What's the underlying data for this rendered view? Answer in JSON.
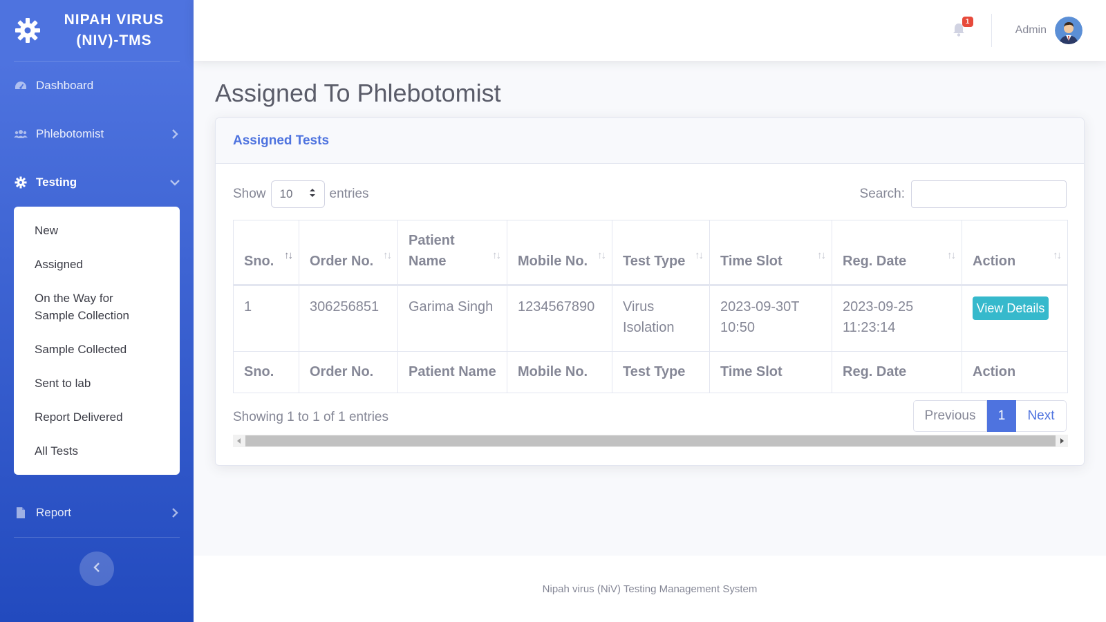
{
  "app": {
    "brand_title": "NIPAH VIRUS (NIV)-TMS",
    "accent_color": "#4e73df",
    "info_color": "#36b9cc",
    "badge_color": "#e74a3b"
  },
  "sidebar": {
    "items": [
      {
        "label": "Dashboard",
        "icon": "dashboard-gauge-icon"
      },
      {
        "label": "Phlebotomist",
        "icon": "users-icon"
      },
      {
        "label": "Testing",
        "icon": "gear-icon"
      },
      {
        "label": "Report",
        "icon": "file-icon"
      }
    ],
    "testing_submenu": [
      "New",
      "Assigned",
      "On the Way for Sample Collection",
      "Sample Collected",
      "Sent to lab",
      "Report Delivered",
      "All Tests"
    ]
  },
  "topbar": {
    "notification_count": "1",
    "user_name": "Admin"
  },
  "page": {
    "title": "Assigned To Phlebotomist",
    "card_title": "Assigned Tests"
  },
  "table_controls": {
    "show_label": "Show",
    "entries_value": "10",
    "entries_label": "entries",
    "search_label": "Search:",
    "search_value": ""
  },
  "table": {
    "columns": [
      "Sno.",
      "Order No.",
      "Patient Name",
      "Mobile No.",
      "Test Type",
      "Time Slot",
      "Reg. Date",
      "Action"
    ],
    "rows": [
      {
        "sno": "1",
        "order_no": "306256851",
        "patient_name": "Garima Singh",
        "mobile": "1234567890",
        "test_type": "Virus Isolation",
        "time_slot": "2023-09-30T10:50",
        "reg_date": "2023-09-25 11:23:14",
        "action": "View Details"
      }
    ]
  },
  "pagination": {
    "info": "Showing 1 to 1 of 1 entries",
    "previous": "Previous",
    "current": "1",
    "next": "Next"
  },
  "footer": {
    "text": "Nipah virus (NiV) Testing Management System"
  }
}
